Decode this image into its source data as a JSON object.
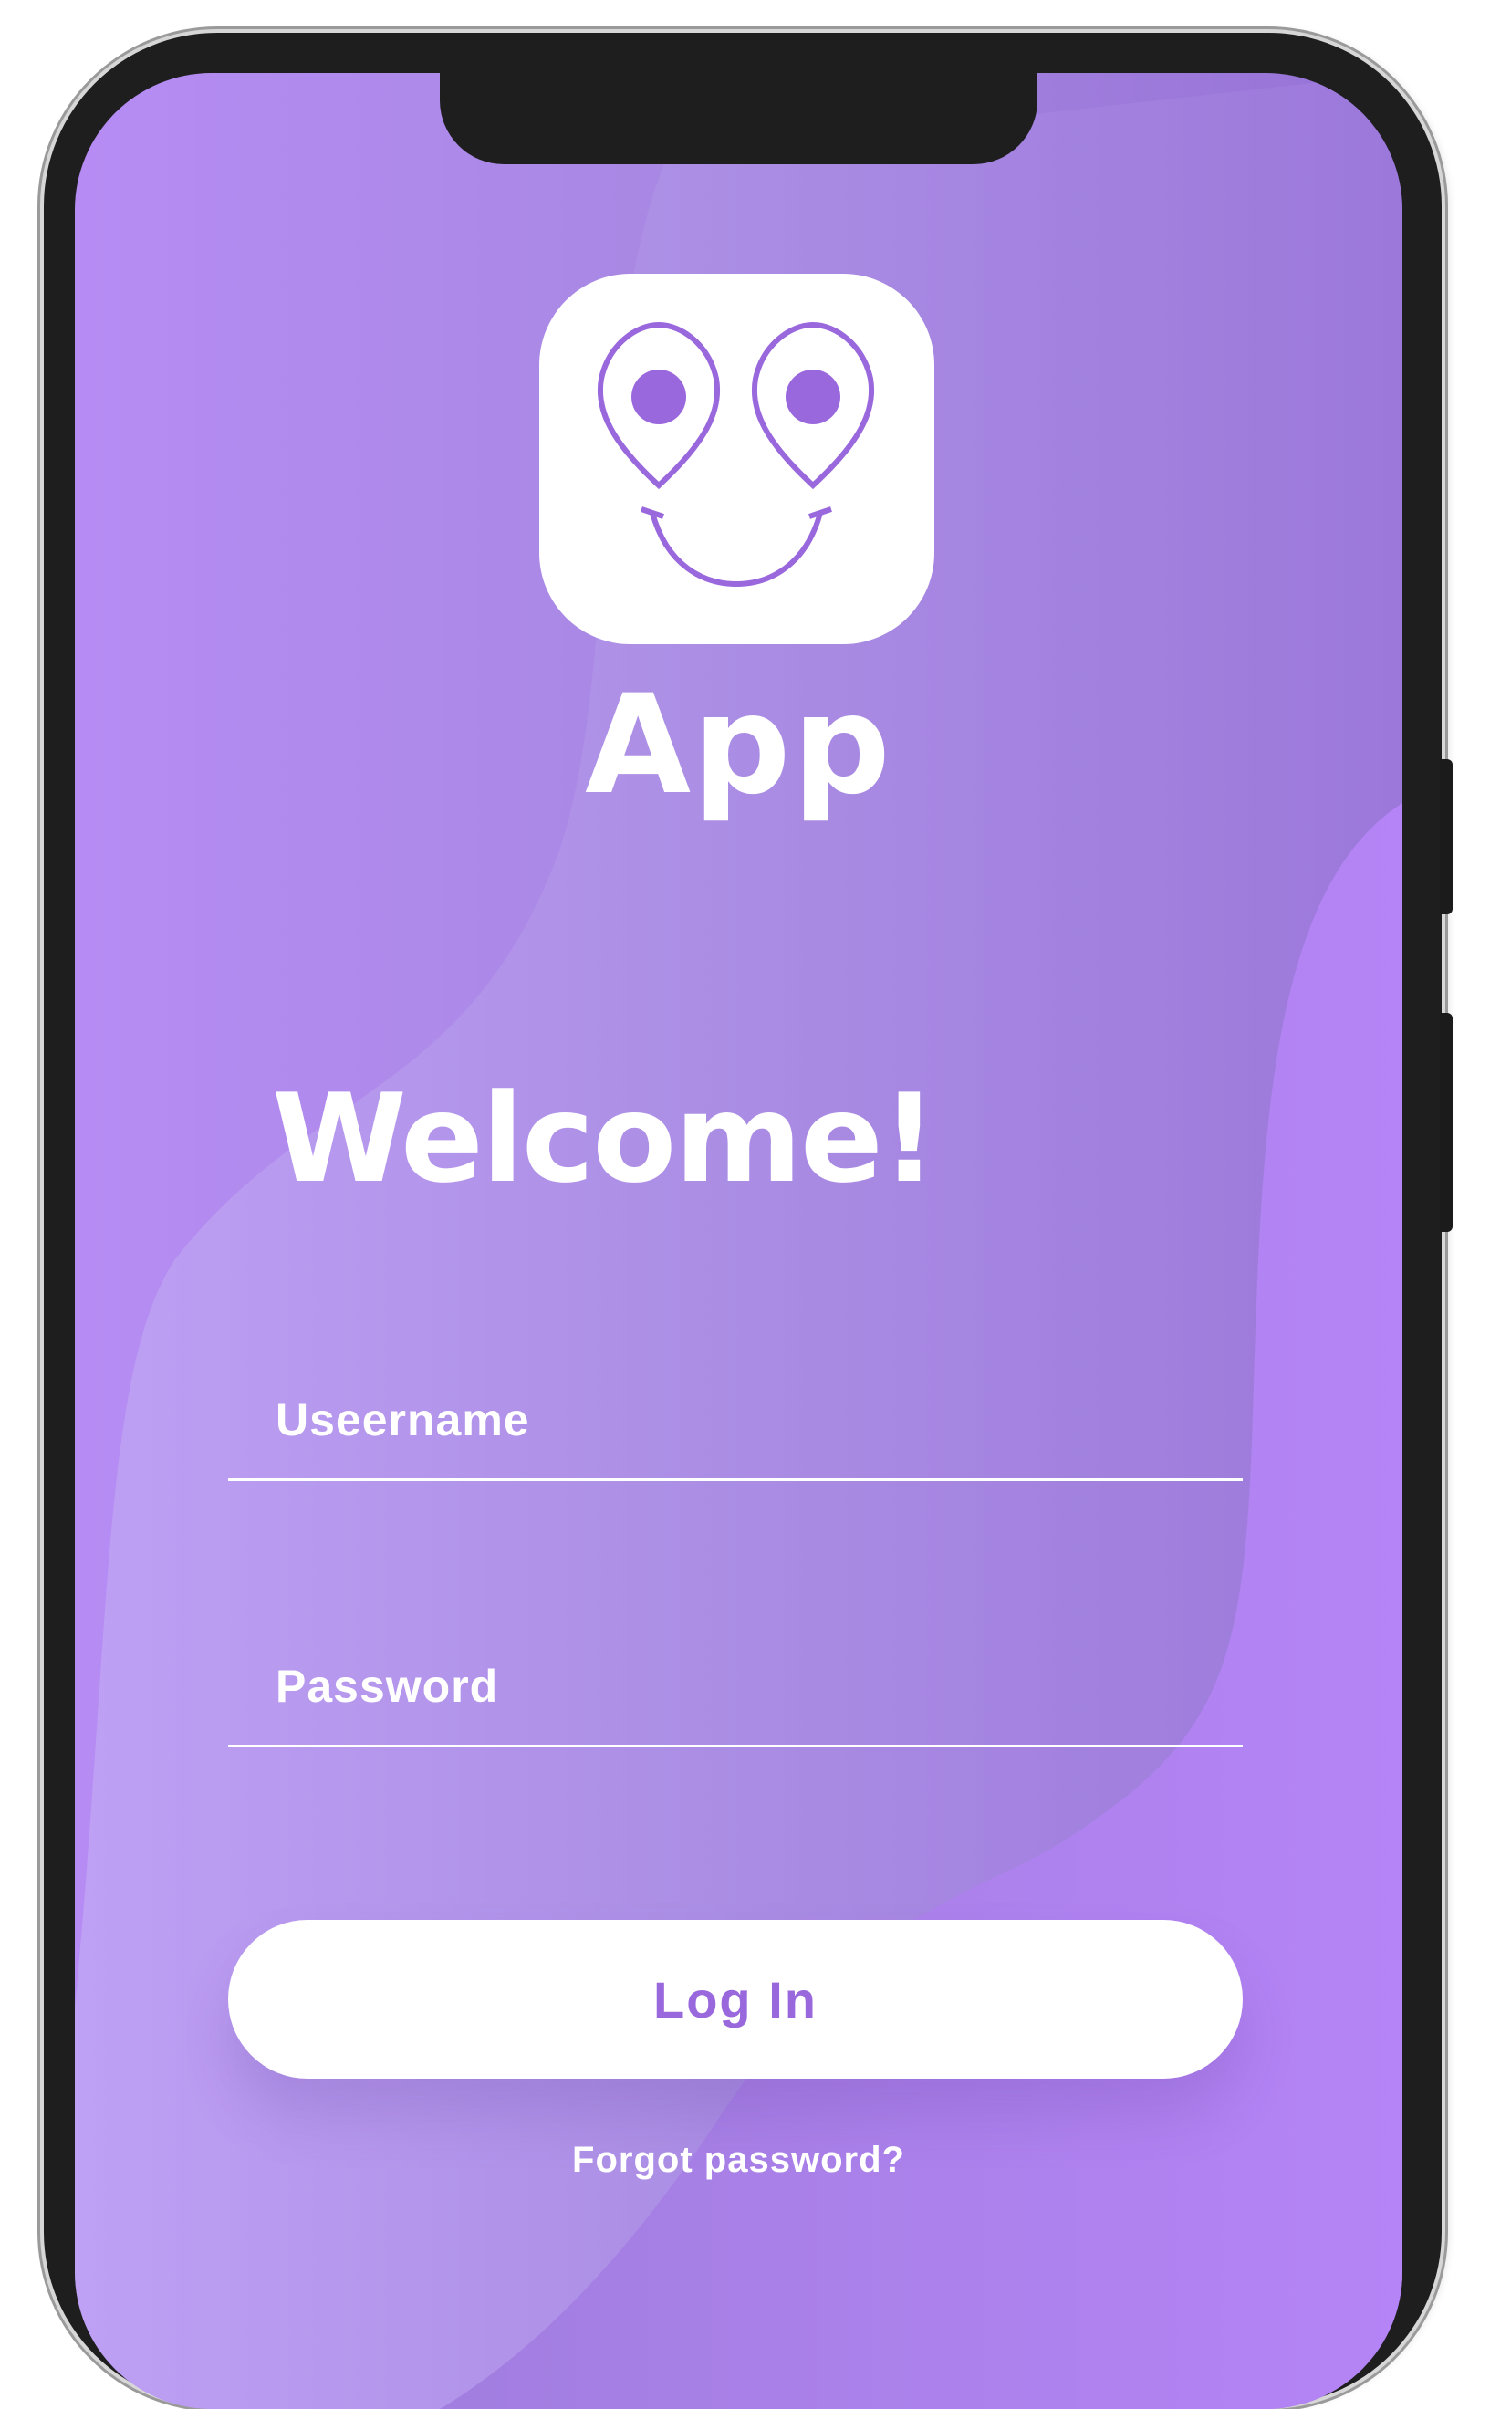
{
  "colors": {
    "accent": "#9a68dd",
    "gradient_start": "#b68cf4",
    "gradient_end": "#9672d6",
    "text": "#ffffff"
  },
  "header": {
    "app_name": "App",
    "logo_icon": "smiley-location-pins-icon"
  },
  "main": {
    "welcome": "Welcome!",
    "username": {
      "placeholder": "Useername",
      "value": ""
    },
    "password": {
      "placeholder": "Password",
      "value": ""
    },
    "login_label": "Log In",
    "forgot_label": "Forgot password?"
  }
}
